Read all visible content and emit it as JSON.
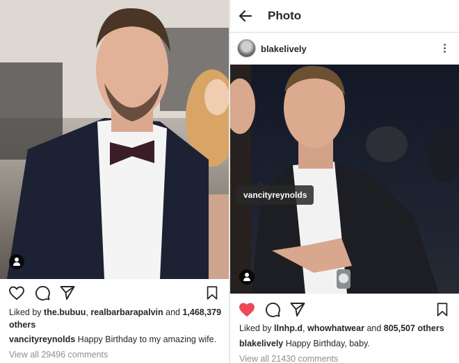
{
  "left_post": {
    "likes": {
      "prefix": "Liked by",
      "user1": "the.bubuu",
      "sep": ",",
      "user2": "realbarbarapalvin",
      "and": "and",
      "count": "1,468,379",
      "suffix": "others"
    },
    "caption": {
      "username": "vancityreynolds",
      "text": "Happy Birthday to my amazing wife."
    },
    "comments_link": "View all 29496 comments"
  },
  "right_post": {
    "topbar_title": "Photo",
    "username": "blakelively",
    "tag_label": "vancityreynolds",
    "liked": true,
    "likes": {
      "prefix": "Liked by",
      "user1": "llnhp.d",
      "sep": ",",
      "user2": "whowhatwear",
      "and": "and",
      "count": "805,507",
      "suffix": "others"
    },
    "caption": {
      "username": "blakelively",
      "text": "Happy Birthday, baby."
    },
    "comments_link": "View all 21430 comments"
  },
  "colors": {
    "like_active": "#ed4956",
    "text_primary": "#262626",
    "text_secondary": "#8e8e8e",
    "divider": "#dbdbdb"
  },
  "icons": [
    "arrow-left-icon",
    "more-vertical-icon",
    "heart-icon",
    "comment-icon",
    "share-icon",
    "bookmark-icon",
    "person-tag-icon"
  ]
}
